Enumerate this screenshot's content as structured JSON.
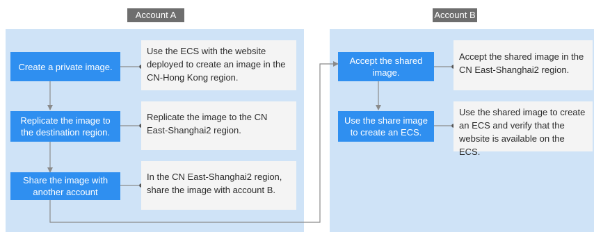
{
  "account_a": {
    "title": "Account A",
    "steps": [
      {
        "label": "Create a private image.",
        "note": "Use the ECS with the website deployed to create an image in the CN-Hong Kong region."
      },
      {
        "label": "Replicate the image to the destination region.",
        "note": "Replicate the image to the CN East-Shanghai2 region."
      },
      {
        "label": "Share the image with another account",
        "note": "In the CN East-Shanghai2 region, share the image with account B."
      }
    ]
  },
  "account_b": {
    "title": "Account B",
    "steps": [
      {
        "label": "Accept the shared image.",
        "note": "Accept the shared image in the CN East-Shanghai2 region."
      },
      {
        "label": "Use the share image to create an ECS.",
        "note": "Use the shared image to create an ECS and verify that the website is available on the ECS."
      }
    ]
  },
  "colors": {
    "panel": "#cfe3f7",
    "step": "#2f8ff0",
    "note": "#f4f4f4",
    "tag": "#6e6e6e",
    "connector": "#8a8a8a"
  }
}
